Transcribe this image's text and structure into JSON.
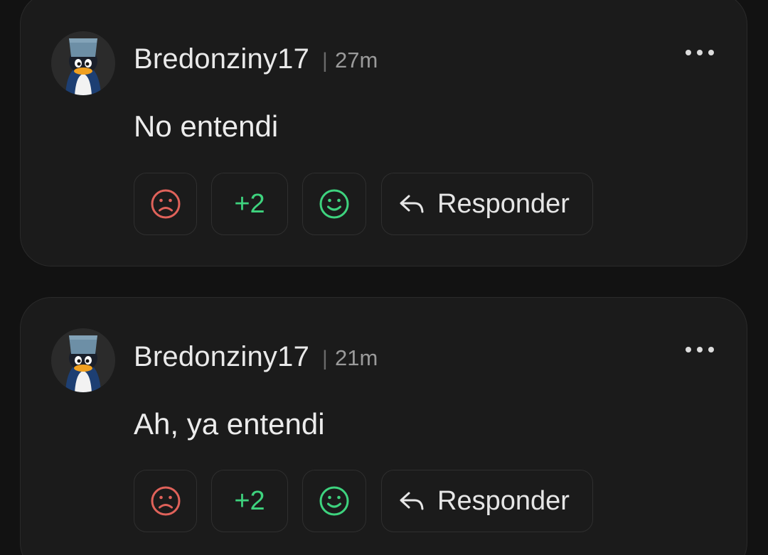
{
  "colors": {
    "background": "#121212",
    "card": "#1b1b1b",
    "sad": "#e0625a",
    "positive": "#3ed37e"
  },
  "comments": [
    {
      "username": "Bredonziny17",
      "separator": "|",
      "time": "27m",
      "text": "No entendi",
      "score": "+2",
      "reply_label": "Responder",
      "icons": {
        "sad": "sad-face-icon",
        "happy": "happy-face-icon",
        "reply": "reply-arrow-icon",
        "more": "more-options-icon"
      }
    },
    {
      "username": "Bredonziny17",
      "separator": "|",
      "time": "21m",
      "text": "Ah, ya entendi",
      "score": "+2",
      "reply_label": "Responder",
      "icons": {
        "sad": "sad-face-icon",
        "happy": "happy-face-icon",
        "reply": "reply-arrow-icon",
        "more": "more-options-icon"
      }
    }
  ]
}
